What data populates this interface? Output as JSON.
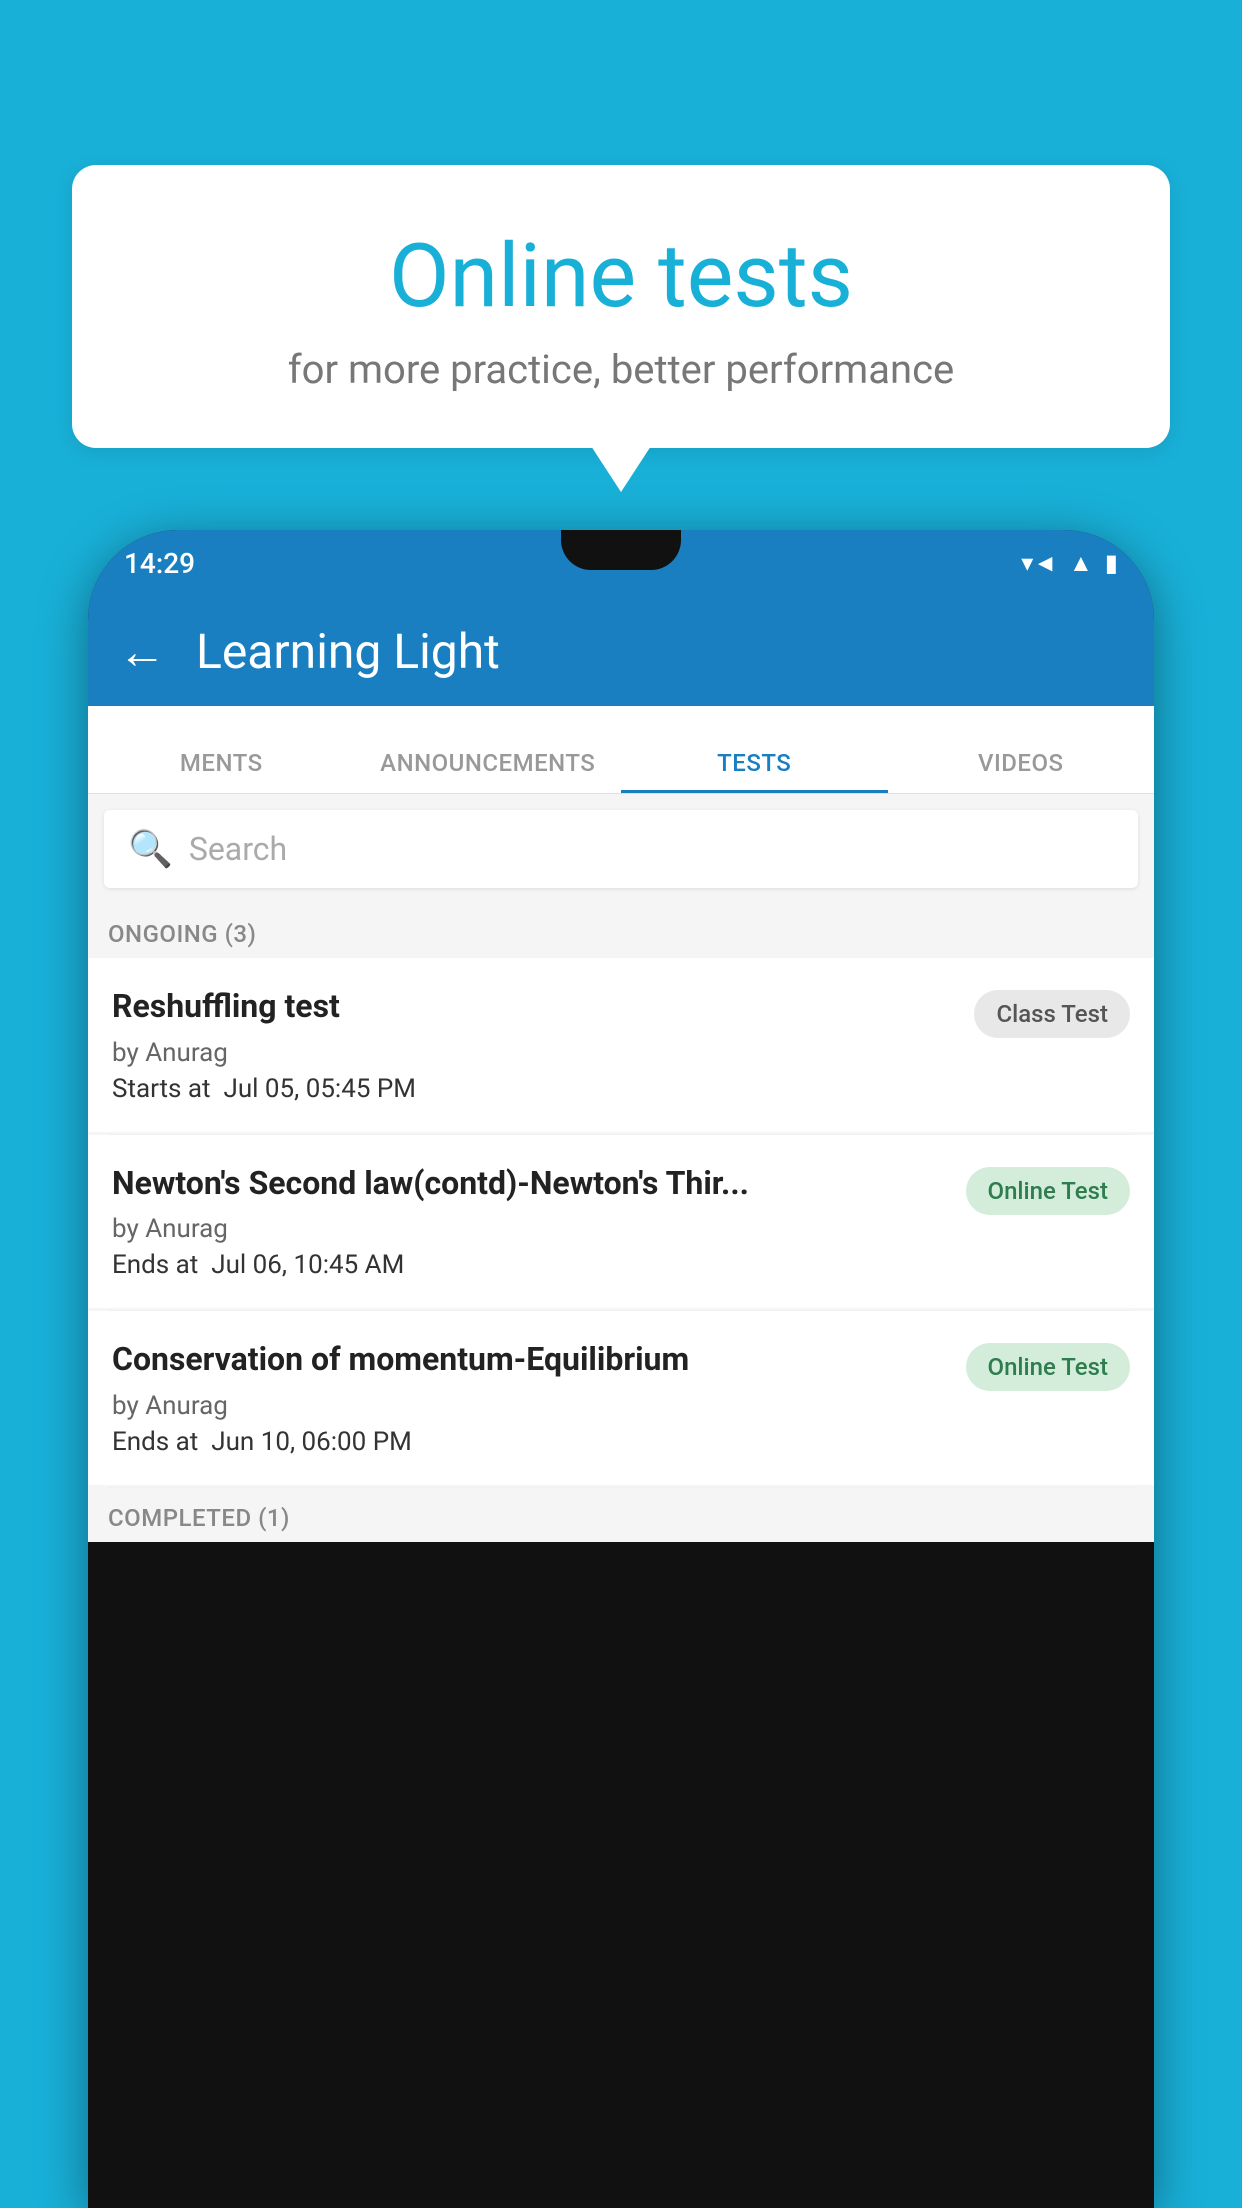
{
  "background_color": "#19b0d8",
  "bubble": {
    "title": "Online tests",
    "subtitle": "for more practice, better performance"
  },
  "status_bar": {
    "time": "14:29",
    "wifi": "▾",
    "signal": "▲",
    "battery": "▮"
  },
  "app_bar": {
    "back_label": "←",
    "title": "Learning Light"
  },
  "tabs": [
    {
      "label": "MENTS",
      "active": false
    },
    {
      "label": "ANNOUNCEMENTS",
      "active": false
    },
    {
      "label": "TESTS",
      "active": true
    },
    {
      "label": "VIDEOS",
      "active": false
    }
  ],
  "search": {
    "placeholder": "Search"
  },
  "sections": [
    {
      "header": "ONGOING (3)",
      "items": [
        {
          "name": "Reshuffling test",
          "author": "by Anurag",
          "time_label": "Starts at",
          "time_value": "Jul 05, 05:45 PM",
          "badge": "Class Test",
          "badge_type": "class"
        },
        {
          "name": "Newton's Second law(contd)-Newton's Thir...",
          "author": "by Anurag",
          "time_label": "Ends at",
          "time_value": "Jul 06, 10:45 AM",
          "badge": "Online Test",
          "badge_type": "online"
        },
        {
          "name": "Conservation of momentum-Equilibrium",
          "author": "by Anurag",
          "time_label": "Ends at",
          "time_value": "Jun 10, 06:00 PM",
          "badge": "Online Test",
          "badge_type": "online"
        }
      ]
    }
  ],
  "completed_label": "COMPLETED (1)"
}
